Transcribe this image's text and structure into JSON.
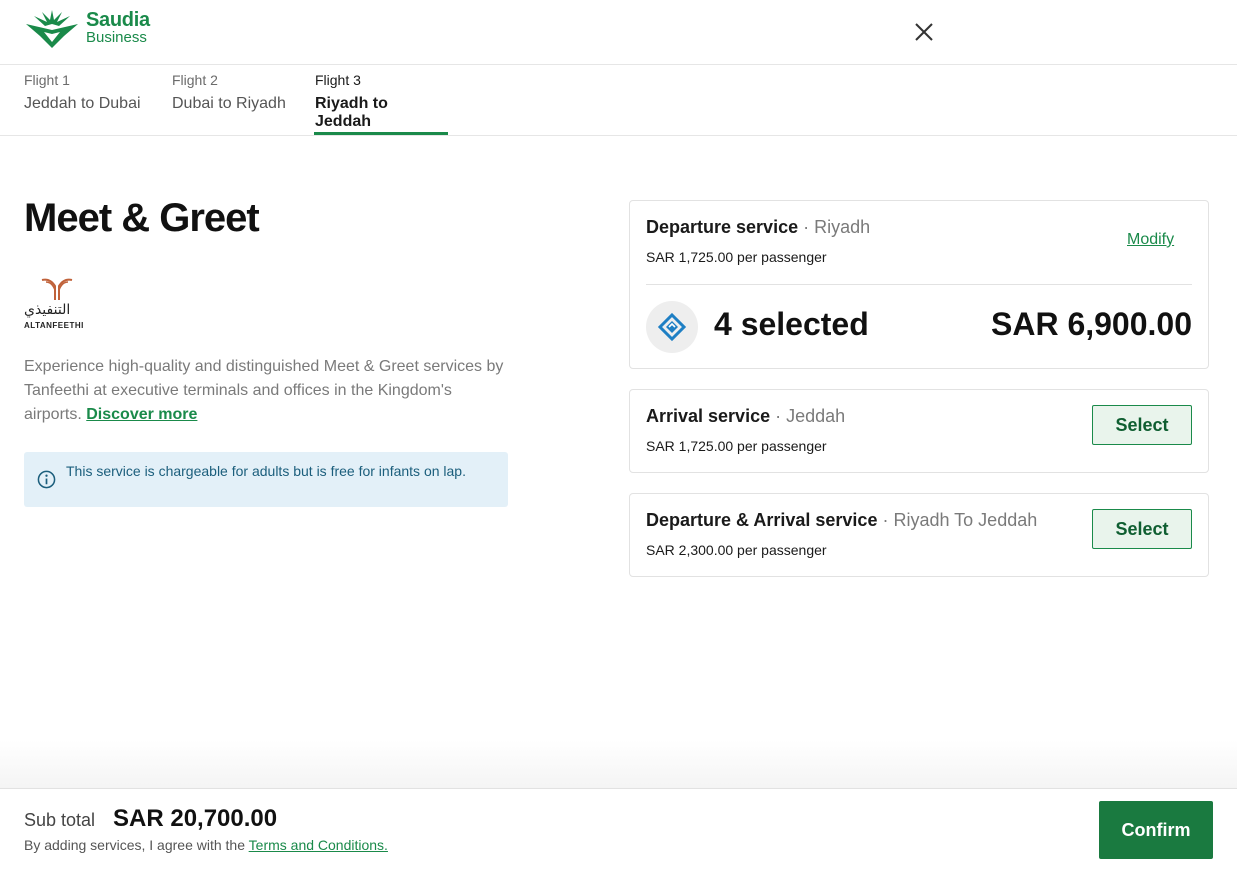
{
  "brand": {
    "name_line1": "Saudia",
    "name_line2": "Business",
    "color": "#1a8a4a"
  },
  "header": {
    "close_icon": "close-icon"
  },
  "tabs": [
    {
      "number": "Flight 1",
      "route": "Jeddah to Dubai",
      "active": false
    },
    {
      "number": "Flight 2",
      "route": "Dubai to Riyadh",
      "active": false
    },
    {
      "number": "Flight 3",
      "route": "Riyadh to Jeddah",
      "active": true
    }
  ],
  "page": {
    "title": "Meet & Greet",
    "partner_logo_arabic": "التنفيذي",
    "partner_logo_english": "ALTANFEETHI",
    "description": "Experience high-quality and distinguished Meet & Greet services by Tanfeethi at executive terminals and offices in the Kingdom's airports.",
    "discover_link": "Discover more",
    "info_text": "This service is chargeable for adults but is free for infants on lap.",
    "info_icon": "info-icon"
  },
  "services": {
    "departure": {
      "title": "Departure service",
      "location": "· Riyadh",
      "price": "SAR 1,725.00 per passenger",
      "modify_label": "Modify",
      "selected_text": "4 selected",
      "total": "SAR 6,900.00",
      "icon": "handshake-icon"
    },
    "arrival": {
      "title": "Arrival service",
      "location": "· Jeddah",
      "price": "SAR 1,725.00 per passenger",
      "select_label": "Select"
    },
    "both": {
      "title": "Departure & Arrival service",
      "location": "· Riyadh To Jeddah",
      "price": "SAR 2,300.00 per passenger",
      "select_label": "Select"
    }
  },
  "footer": {
    "subtotal_label": "Sub total",
    "subtotal_value": "SAR 20,700.00",
    "terms_prefix": "By adding services, I agree with the",
    "terms_link": "Terms and Conditions.",
    "confirm_label": "Confirm",
    "confirm_color": "#1a7a40"
  }
}
